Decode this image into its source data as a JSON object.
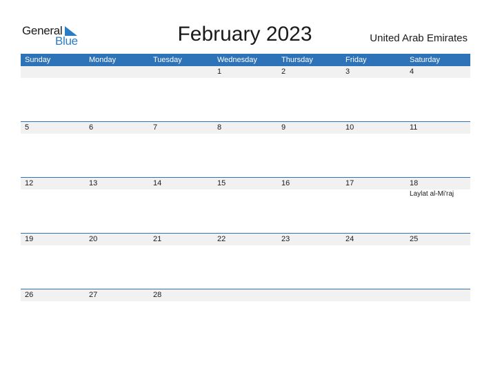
{
  "logo": {
    "word1": "General",
    "word2": "Blue"
  },
  "title": "February 2023",
  "country": "United Arab Emirates",
  "colors": {
    "accent": "#2e73b7",
    "strip": "#f1f1f1"
  },
  "days_of_week": [
    "Sunday",
    "Monday",
    "Tuesday",
    "Wednesday",
    "Thursday",
    "Friday",
    "Saturday"
  ],
  "weeks": [
    [
      {
        "day": ""
      },
      {
        "day": ""
      },
      {
        "day": ""
      },
      {
        "day": "1"
      },
      {
        "day": "2"
      },
      {
        "day": "3"
      },
      {
        "day": "4"
      }
    ],
    [
      {
        "day": "5"
      },
      {
        "day": "6"
      },
      {
        "day": "7"
      },
      {
        "day": "8"
      },
      {
        "day": "9"
      },
      {
        "day": "10"
      },
      {
        "day": "11"
      }
    ],
    [
      {
        "day": "12"
      },
      {
        "day": "13"
      },
      {
        "day": "14"
      },
      {
        "day": "15"
      },
      {
        "day": "16"
      },
      {
        "day": "17"
      },
      {
        "day": "18",
        "event": "Laylat al-Mi'raj"
      }
    ],
    [
      {
        "day": "19"
      },
      {
        "day": "20"
      },
      {
        "day": "21"
      },
      {
        "day": "22"
      },
      {
        "day": "23"
      },
      {
        "day": "24"
      },
      {
        "day": "25"
      }
    ],
    [
      {
        "day": "26"
      },
      {
        "day": "27"
      },
      {
        "day": "28"
      },
      {
        "day": ""
      },
      {
        "day": ""
      },
      {
        "day": ""
      },
      {
        "day": ""
      }
    ]
  ]
}
